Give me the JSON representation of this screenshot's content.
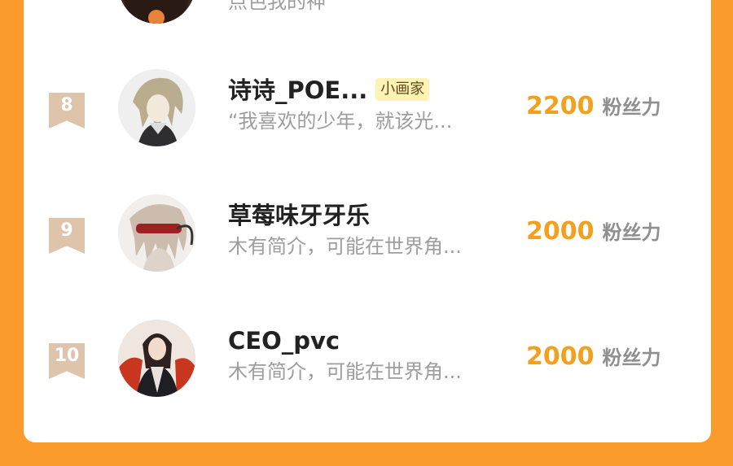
{
  "ranking": {
    "fans_unit": "粉丝力",
    "top_partial_bio": "点色我的神",
    "rows": [
      {
        "rank": "8",
        "name": "诗诗_POE...",
        "badge": "小画家",
        "bio": "“我喜欢的少年，就该光...",
        "fans": "2200"
      },
      {
        "rank": "9",
        "name": "草莓味牙牙乐",
        "badge": "",
        "bio": "木有简介，可能在世界角...",
        "fans": "2000"
      },
      {
        "rank": "10",
        "name": "CEO_pvc",
        "badge": "",
        "bio": "木有简介，可能在世界角...",
        "fans": "2000"
      }
    ]
  },
  "colors": {
    "background": "#fb9b2b",
    "fans_number": "#f4a01f",
    "rank_badge": "#dec4aa",
    "title_badge_bg": "#fff3b3"
  }
}
